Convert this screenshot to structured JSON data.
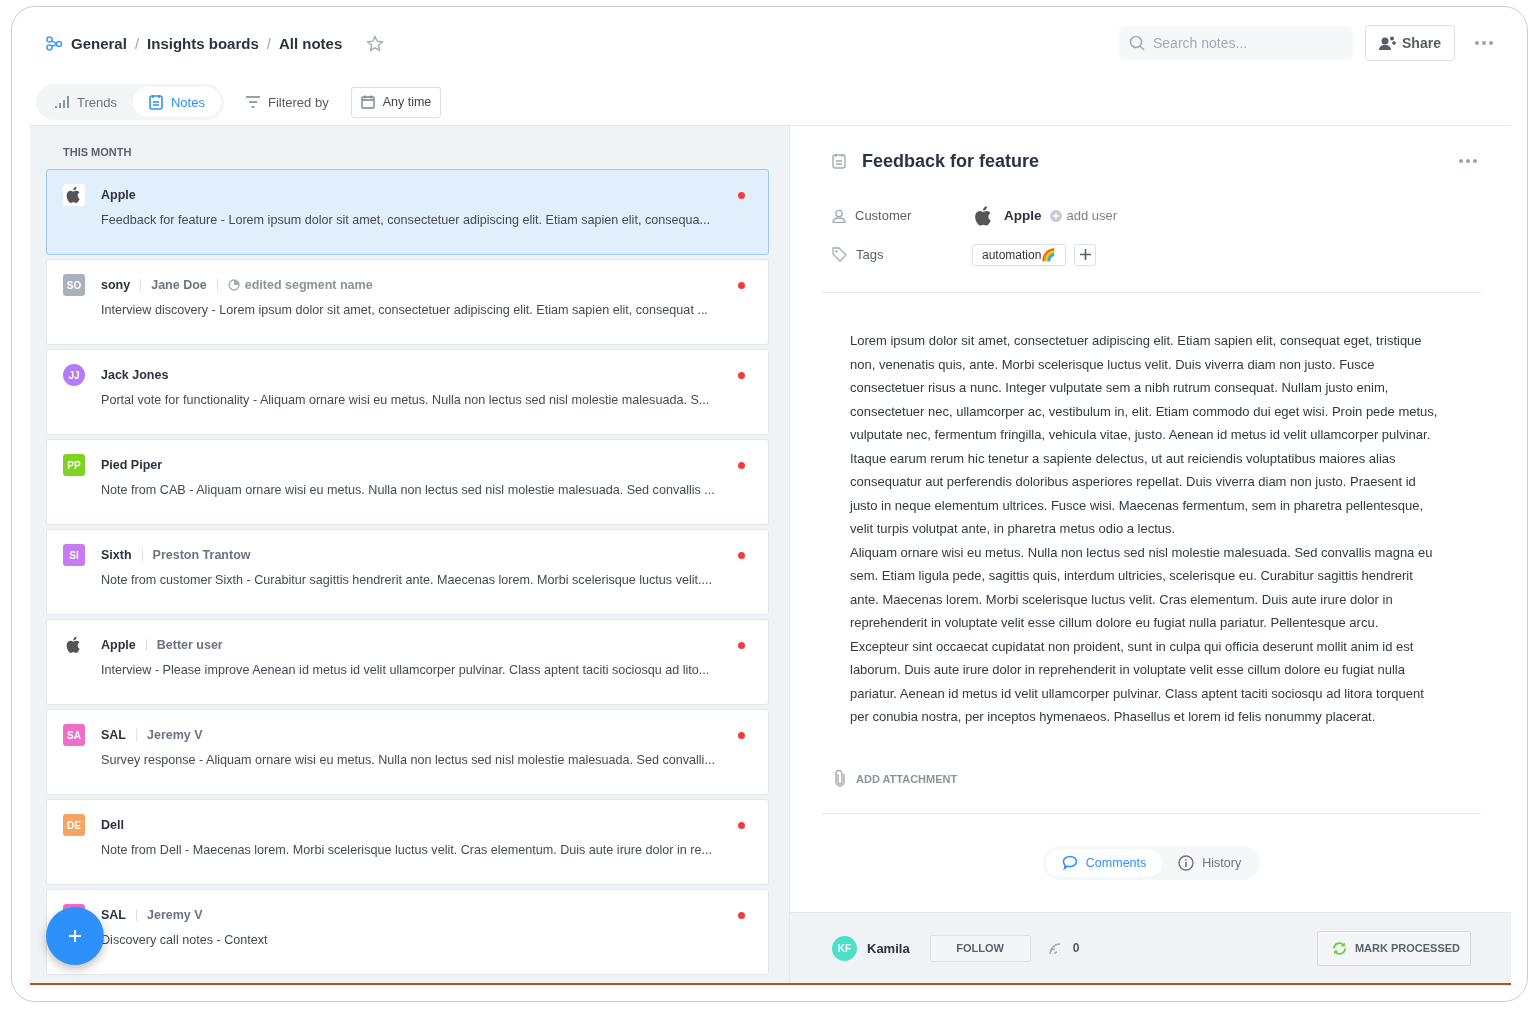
{
  "breadcrumb": [
    {
      "label": "General"
    },
    {
      "label": "Insights boards"
    },
    {
      "label": "All notes"
    }
  ],
  "breadcrumb_separators": [
    "/",
    "/"
  ],
  "starred": false,
  "search": {
    "placeholder": "Search notes..."
  },
  "share_button": "Share",
  "view_tabs": [
    {
      "kind": "trends",
      "label": "Trends",
      "selected": false
    },
    {
      "kind": "notes",
      "label": "Notes",
      "selected": true
    }
  ],
  "filter": "Filtered by",
  "date_filter": "Any time",
  "section": "THIS MONTH",
  "notes": [
    {
      "company": "Apple",
      "avatar": {
        "kind": "logo"
      },
      "text": "Feedback for feature - Lorem ipsum dolor sit amet, consectetuer adipiscing elit. Etiam sapien elit, consequa...",
      "unread": true,
      "selected": true
    },
    {
      "company": "sony",
      "avatar": {
        "kind": "company",
        "initials": "SO",
        "color": "#a9b2bc"
      },
      "user": "Jane Doe",
      "segment": "edited segment name",
      "text": "Interview discovery - Lorem ipsum dolor sit amet, consectetuer adipiscing elit. Etiam sapien elit, consequat ...",
      "unread": true,
      "selected": false
    },
    {
      "company": "Jack Jones",
      "avatar": {
        "kind": "person",
        "initials": "JJ",
        "color": "#b57cf7"
      },
      "text": "Portal vote for functionality - Aliquam ornare wisi eu metus. Nulla non lectus sed nisl molestie malesuada. S...",
      "unread": true,
      "selected": false
    },
    {
      "company": "Pied Piper",
      "avatar": {
        "kind": "company",
        "initials": "PP",
        "color": "#7ed321"
      },
      "text": "Note from CAB - Aliquam ornare wisi eu metus. Nulla non lectus sed nisl molestie malesuada. Sed convallis ...",
      "unread": true,
      "selected": false
    },
    {
      "company": "Sixth",
      "avatar": {
        "kind": "company",
        "initials": "SI",
        "color": "#c57cf0"
      },
      "user": "Preston Trantow",
      "text": "Note from customer Sixth - Curabitur sagittis hendrerit ante. Maecenas lorem. Morbi scelerisque luctus velit....",
      "unread": true,
      "selected": false
    },
    {
      "company": "Apple",
      "avatar": {
        "kind": "logo"
      },
      "user": "Better user",
      "text": "Interview - Please improve Aenean id metus id velit ullamcorper pulvinar. Class aptent taciti sociosqu ad lito...",
      "unread": true,
      "selected": false
    },
    {
      "company": "SAL",
      "avatar": {
        "kind": "company",
        "initials": "SA",
        "color": "#f06ec9"
      },
      "user": "Jeremy V",
      "text": "Survey response - Aliquam ornare wisi eu metus. Nulla non lectus sed nisl molestie malesuada. Sed convalli...",
      "unread": true,
      "selected": false
    },
    {
      "company": "Dell",
      "avatar": {
        "kind": "company",
        "initials": "DE",
        "color": "#f5a55f"
      },
      "text": "Note from Dell - Maecenas lorem. Morbi scelerisque luctus velit. Cras elementum. Duis aute irure dolor in re...",
      "unread": true,
      "selected": false
    },
    {
      "company": "SAL",
      "avatar": {
        "kind": "company",
        "color": "#f06ec9"
      },
      "user": "Jeremy V",
      "text": "Discovery call notes - Context",
      "unread": true,
      "selected": false
    }
  ],
  "detail": {
    "title": "Feedback for feature",
    "customer": {
      "label": "Customer",
      "value": "Apple",
      "add": "add user"
    },
    "tags": {
      "label": "Tags",
      "items": [
        "automation🌈"
      ]
    },
    "body": [
      "Lorem ipsum dolor sit amet, consectetuer adipiscing elit. Etiam sapien elit, consequat eget, tristique non, venenatis quis, ante. Morbi scelerisque luctus velit. Duis viverra diam non justo. Fusce consectetuer risus a nunc. Integer vulputate sem a nibh rutrum consequat. Nullam justo enim, consectetuer nec, ullamcorper ac, vestibulum in, elit. Etiam commodo dui eget wisi. Proin pede metus, vulputate nec, fermentum fringilla, vehicula vitae, justo. Aenean id metus id velit ullamcorper pulvinar. Itaque earum rerum hic tenetur a sapiente delectus, ut aut reiciendis voluptatibus maiores alias consequatur aut perferendis doloribus asperiores repellat. Duis viverra diam non justo. Praesent id justo in neque elementum ultrices. Fusce wisi. Maecenas fermentum, sem in pharetra pellentesque, velit turpis volutpat ante, in pharetra metus odio a lectus.",
      "Aliquam ornare wisi eu metus. Nulla non lectus sed nisl molestie malesuada. Sed convallis magna eu sem. Etiam ligula pede, sagittis quis, interdum ultricies, scelerisque eu. Curabitur sagittis hendrerit ante. Maecenas lorem. Morbi scelerisque luctus velit. Cras elementum. Duis aute irure dolor in reprehenderit in voluptate velit esse cillum dolore eu fugiat nulla pariatur. Pellentesque arcu. Excepteur sint occaecat cupidatat non proident, sunt in culpa qui officia deserunt mollit anim id est laborum. Duis aute irure dolor in reprehenderit in voluptate velit esse cillum dolore eu fugiat nulla pariatur. Aenean id metus id velit ullamcorper pulvinar. Class aptent taciti sociosqu ad litora torquent per conubia nostra, per inceptos hymenaeos. Phasellus et lorem id felis nonummy placerat."
    ],
    "attachment": "ADD ATTACHMENT",
    "tabs": [
      {
        "kind": "comments",
        "label": "Comments",
        "selected": true
      },
      {
        "kind": "history",
        "label": "History",
        "selected": false
      }
    ],
    "footer": {
      "initials": "KF",
      "name": "Kamila",
      "follow": "FOLLOW",
      "count": "0",
      "mark": "MARK PROCESSED"
    }
  }
}
